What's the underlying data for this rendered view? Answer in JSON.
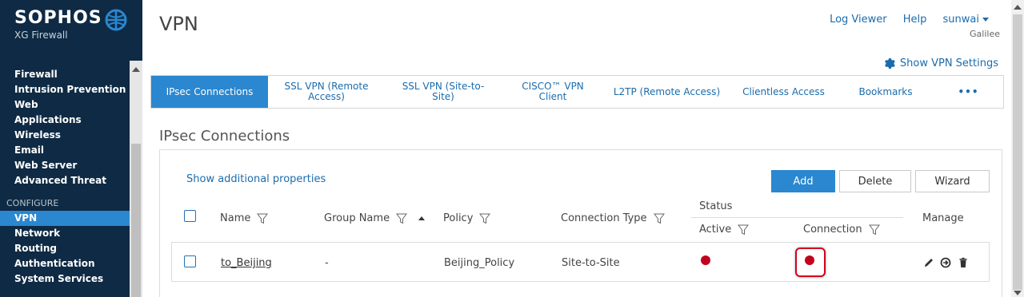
{
  "brand": {
    "name": "SOPHOS",
    "product": "XG Firewall"
  },
  "sidebar": {
    "items_top": [
      "Firewall",
      "Intrusion Prevention",
      "Web",
      "Applications",
      "Wireless",
      "Email",
      "Web Server",
      "Advanced Threat"
    ],
    "section": "CONFIGURE",
    "items_config": [
      "VPN",
      "Network",
      "Routing",
      "Authentication",
      "System Services"
    ],
    "active": "VPN"
  },
  "header": {
    "title": "VPN",
    "log_viewer": "Log Viewer",
    "help": "Help",
    "user": "sunwai",
    "user_sub": "Galilee",
    "settings_link": "Show VPN Settings"
  },
  "tabs": [
    "IPsec Connections",
    "SSL VPN (Remote Access)",
    "SSL VPN (Site-to-Site)",
    "CISCO™ VPN Client",
    "L2TP (Remote Access)",
    "Clientless Access",
    "Bookmarks",
    "•••"
  ],
  "section": {
    "title": "IPsec Connections",
    "show_props": "Show additional properties",
    "add": "Add",
    "delete": "Delete",
    "wizard": "Wizard"
  },
  "table": {
    "headers": {
      "name": "Name",
      "group_name": "Group Name",
      "policy": "Policy",
      "connection_type": "Connection Type",
      "status": "Status",
      "active": "Active",
      "connection": "Connection",
      "manage": "Manage"
    },
    "rows": [
      {
        "name": "to_Beijing",
        "group_name": "-",
        "policy": "Beijing_Policy",
        "connection_type": "Site-to-Site",
        "active": "inactive",
        "connection": "disconnected"
      }
    ]
  },
  "colors": {
    "sidebar_bg": "#0f2a44",
    "accent": "#2a87d0",
    "link": "#1b6cad",
    "status_red": "#c3001d",
    "highlight": "#d40020"
  }
}
